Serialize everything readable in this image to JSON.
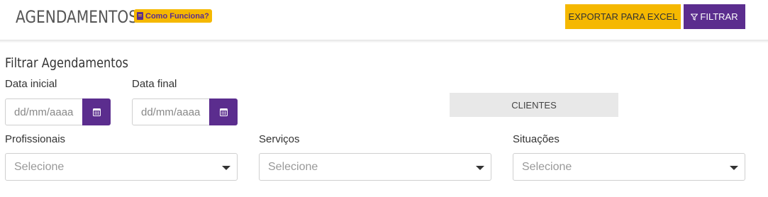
{
  "header": {
    "title": "AGENDAMENTOS",
    "help_badge": "Como Funciona?",
    "export_button": "EXPORTAR PARA EXCEL",
    "filter_button": "FILTRAR"
  },
  "filters": {
    "section_title": "Filtrar Agendamentos",
    "start_date": {
      "label": "Data inicial",
      "placeholder": "dd/mm/aaaa"
    },
    "end_date": {
      "label": "Data final",
      "placeholder": "dd/mm/aaaa"
    },
    "clients_tab": "CLIENTES",
    "professionals": {
      "label": "Profissionais",
      "value": "Selecione"
    },
    "services": {
      "label": "Serviços",
      "value": "Selecione"
    },
    "statuses": {
      "label": "Situações",
      "value": "Selecione"
    }
  },
  "colors": {
    "accent_purple": "#5b2d8e",
    "accent_yellow": "#f5b800"
  },
  "icons": [
    "book-icon",
    "funnel-icon",
    "calendar-icon",
    "caret-down-icon"
  ]
}
